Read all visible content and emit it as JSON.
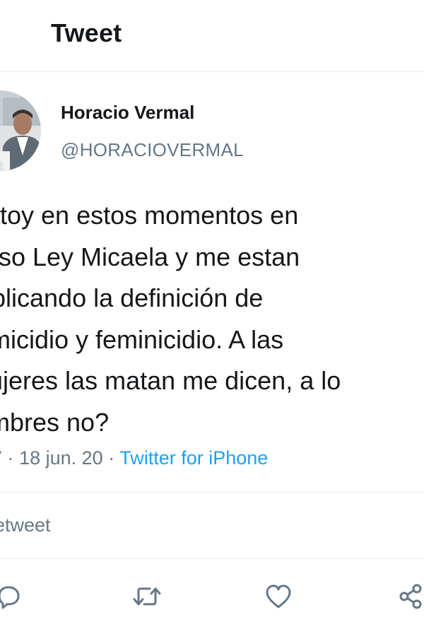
{
  "header": {
    "title": "Tweet"
  },
  "author": {
    "name": "Horacio Vermal",
    "handle": "@HORACIOVERMAL"
  },
  "tweet": {
    "lines": [
      "toy en estos momentos en",
      "rso Ley Micaela y me estan",
      "plicando la definición de",
      "micidio y feminicidio. A las",
      "ujeres las matan me dicen, a lo",
      "mbres no?"
    ]
  },
  "meta": {
    "time_fragment": "7",
    "separator": "·",
    "date": "18 jun. 20",
    "source": "Twitter for iPhone"
  },
  "stats": {
    "retweets_label": "etweet"
  },
  "actions": {
    "reply_icon": "reply-icon",
    "retweet_icon": "retweet-icon",
    "like_icon": "heart-icon",
    "share_icon": "share-icon"
  },
  "colors": {
    "text": "#14171a",
    "muted": "#657786",
    "link": "#1da1f2",
    "divider": "#e6ecf0"
  }
}
